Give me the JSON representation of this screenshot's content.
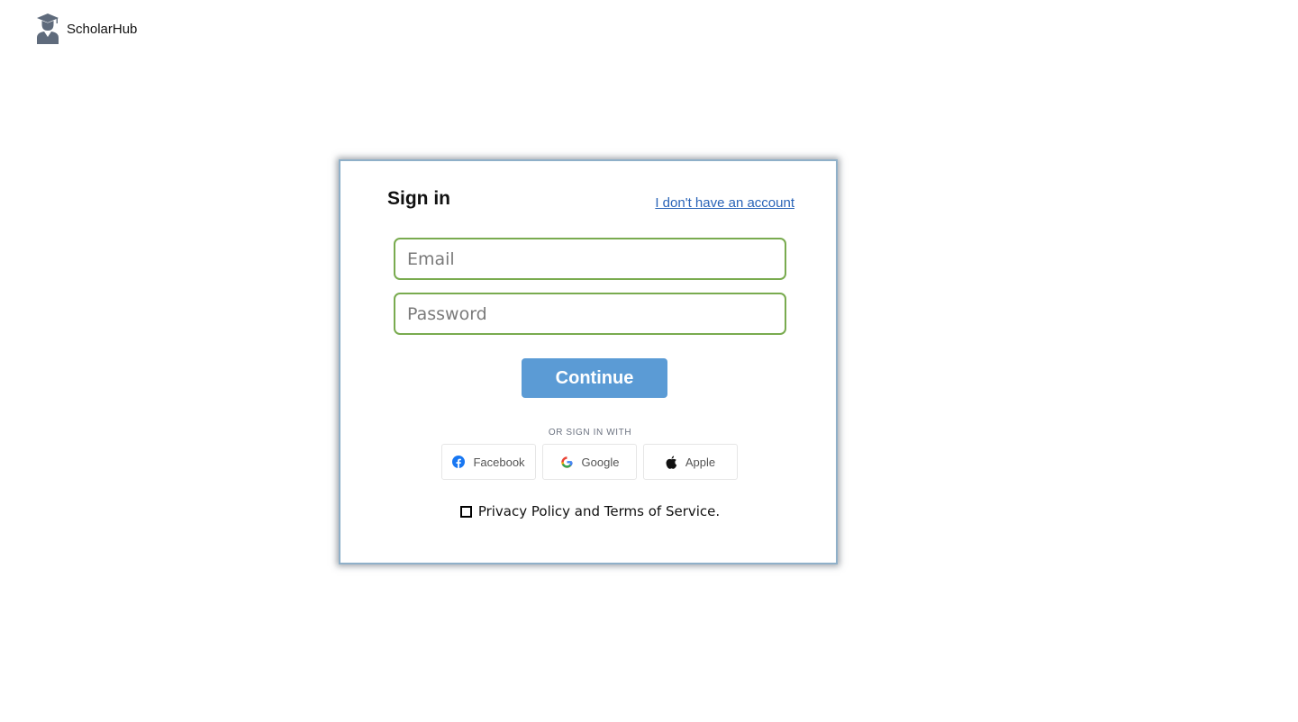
{
  "brand": {
    "name": "ScholarHub",
    "logo_icon": "graduate-student-icon"
  },
  "signin": {
    "title": "Sign in",
    "no_account_link": "I don't have an account",
    "email_placeholder": "Email",
    "password_placeholder": "Password",
    "continue_label": "Continue",
    "or_sign_in_with": "OR SIGN IN WITH",
    "social": [
      {
        "label": "Facebook",
        "icon": "facebook-icon"
      },
      {
        "label": "Google",
        "icon": "google-icon"
      },
      {
        "label": "Apple",
        "icon": "apple-icon"
      }
    ],
    "terms_text": "Privacy Policy and Terms of Service."
  },
  "colors": {
    "accent": "#5b9bd5",
    "field_border": "#79ab4f",
    "link": "#2a64b8",
    "card_border": "#8fb0c9"
  }
}
